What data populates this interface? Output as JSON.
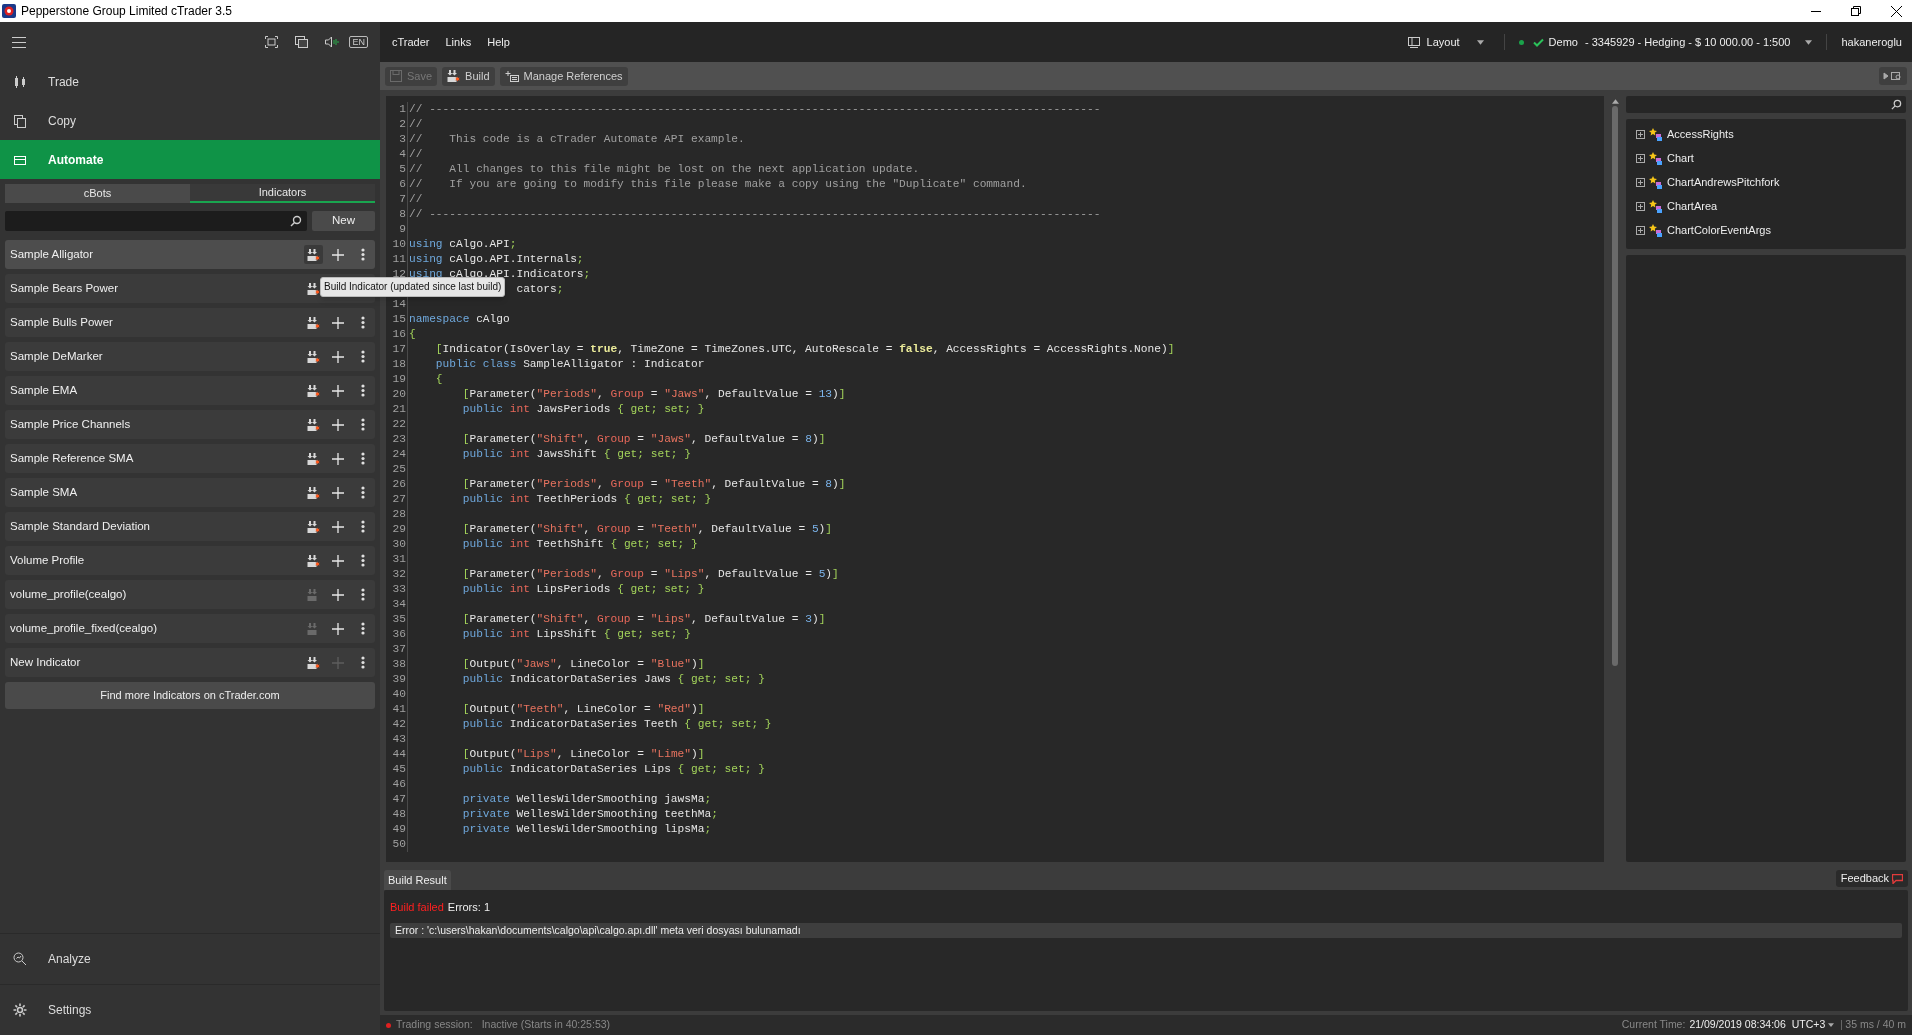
{
  "window": {
    "title": "Pepperstone Group Limited cTrader 3.5"
  },
  "sidebar": {
    "keyboard_badge": "EN",
    "nav_top": [
      {
        "label": "Trade",
        "kind": "trade",
        "selected": false
      },
      {
        "label": "Copy",
        "kind": "copy",
        "selected": false
      },
      {
        "label": "Automate",
        "kind": "automate",
        "selected": true
      }
    ],
    "tabs": [
      {
        "label": "cBots",
        "selected": false
      },
      {
        "label": "Indicators",
        "selected": true
      }
    ],
    "new_button": "New",
    "items": [
      {
        "name": "Sample Alligator",
        "selected": true,
        "modified": true,
        "add_enabled": true
      },
      {
        "name": "Sample Bears Power",
        "selected": false,
        "modified": true,
        "tooltip": "Build Indicator (updated since last build)"
      },
      {
        "name": "Sample Bulls Power",
        "selected": false,
        "modified": true,
        "add_enabled": true
      },
      {
        "name": "Sample DeMarker",
        "selected": false,
        "modified": true,
        "add_enabled": true
      },
      {
        "name": "Sample EMA",
        "selected": false,
        "modified": true,
        "add_enabled": true
      },
      {
        "name": "Sample Price Channels",
        "selected": false,
        "modified": true,
        "add_enabled": true
      },
      {
        "name": "Sample Reference SMA",
        "selected": false,
        "modified": true,
        "add_enabled": true
      },
      {
        "name": "Sample SMA",
        "selected": false,
        "modified": true,
        "add_enabled": true
      },
      {
        "name": "Sample Standard Deviation",
        "selected": false,
        "modified": true,
        "add_enabled": true
      },
      {
        "name": "Volume Profile",
        "selected": false,
        "modified": true,
        "add_enabled": true
      },
      {
        "name": "volume_profile(cealgo)",
        "selected": false,
        "modified": false,
        "add_enabled": true
      },
      {
        "name": "volume_profile_fixed(cealgo)",
        "selected": false,
        "modified": false,
        "add_enabled": true
      },
      {
        "name": "New Indicator",
        "selected": false,
        "modified": true,
        "add_enabled": false
      }
    ],
    "find_more": "Find more Indicators on cTrader.com",
    "nav_bottom": [
      {
        "label": "Analyze",
        "kind": "analyze",
        "selected": false
      },
      {
        "label": "Settings",
        "kind": "settings",
        "selected": false
      }
    ]
  },
  "menu": [
    "cTrader",
    "Links",
    "Help"
  ],
  "header": {
    "layout": "Layout",
    "account_type": "Demo",
    "account": "- 3345929 - Hedging - $ 10 000.00 - 1:500",
    "user": "hakaneroglu"
  },
  "toolbar": [
    {
      "label": "Save",
      "kind": "save",
      "disabled": true
    },
    {
      "label": "Build",
      "kind": "build",
      "disabled": false
    },
    {
      "label": "Manage References",
      "kind": "references",
      "disabled": false
    }
  ],
  "code": [
    {
      "number": "1",
      "tokens": [
        {
          "kind": "comment",
          "text": "// ----------------------------------------------------------------------------------------------------"
        }
      ]
    },
    {
      "number": "2",
      "tokens": [
        {
          "kind": "comment",
          "text": "//"
        }
      ]
    },
    {
      "number": "3",
      "tokens": [
        {
          "kind": "comment",
          "text": "//    This code is a cTrader Automate API example."
        }
      ]
    },
    {
      "number": "4",
      "tokens": [
        {
          "kind": "comment",
          "text": "//"
        }
      ]
    },
    {
      "number": "5",
      "tokens": [
        {
          "kind": "comment",
          "text": "//    All changes to this file might be lost on the next application update."
        }
      ]
    },
    {
      "number": "6",
      "tokens": [
        {
          "kind": "comment",
          "text": "//    If you are going to modify this file please make a copy using the \"Duplicate\" command."
        }
      ]
    },
    {
      "number": "7",
      "tokens": [
        {
          "kind": "comment",
          "text": "//"
        }
      ]
    },
    {
      "number": "8",
      "tokens": [
        {
          "kind": "comment",
          "text": "// ----------------------------------------------------------------------------------------------------"
        }
      ]
    },
    {
      "number": "9"
    },
    {
      "number": "10",
      "tokens": [
        {
          "kind": "keyword",
          "text": "using"
        },
        {
          "kind": "plain",
          "text": " cAlgo.API"
        },
        {
          "kind": "punct",
          "text": ";"
        }
      ]
    },
    {
      "number": "11",
      "tokens": [
        {
          "kind": "keyword",
          "text": "using"
        },
        {
          "kind": "plain",
          "text": " cAlgo.API.Internals"
        },
        {
          "kind": "punct",
          "text": ";"
        }
      ]
    },
    {
      "number": "12",
      "tokens": [
        {
          "kind": "keyword",
          "text": "using"
        },
        {
          "kind": "plain",
          "text": " cAlgo.API.Indicators"
        },
        {
          "kind": "punct",
          "text": ";"
        }
      ]
    },
    {
      "tokens": [
        {
          "kind": "plain",
          "text": "                cators"
        },
        {
          "kind": "punct",
          "text": ";"
        }
      ]
    },
    {
      "number": "14"
    },
    {
      "number": "15",
      "tokens": [
        {
          "kind": "keyword",
          "text": "namespace"
        },
        {
          "kind": "plain",
          "text": " cAlgo"
        }
      ]
    },
    {
      "number": "16",
      "tokens": [
        {
          "kind": "punct",
          "text": "{"
        }
      ]
    },
    {
      "number": "17",
      "tokens": [
        {
          "kind": "punct",
          "text": "    ["
        },
        {
          "kind": "plain",
          "text": "Indicator(IsOverlay = "
        },
        {
          "kind": "literal",
          "text": "true"
        },
        {
          "kind": "plain",
          "text": ", TimeZone = TimeZones.UTC, AutoRescale = "
        },
        {
          "kind": "literal",
          "text": "false"
        },
        {
          "kind": "plain",
          "text": ", AccessRights = AccessRights.None)"
        },
        {
          "kind": "punct",
          "text": "]"
        }
      ]
    },
    {
      "number": "18",
      "tokens": [
        {
          "kind": "keyword",
          "text": "    public class"
        },
        {
          "kind": "plain",
          "text": " SampleAlligator : Indicator"
        }
      ]
    },
    {
      "number": "19",
      "tokens": [
        {
          "kind": "punct",
          "text": "    {"
        }
      ]
    },
    {
      "number": "20",
      "tokens": [
        {
          "kind": "punct",
          "text": "        ["
        },
        {
          "kind": "plain",
          "text": "Parameter("
        },
        {
          "kind": "string",
          "text": "\"Periods\""
        },
        {
          "kind": "plain",
          "text": ", "
        },
        {
          "kind": "param",
          "text": "Group"
        },
        {
          "kind": "plain",
          "text": " = "
        },
        {
          "kind": "string",
          "text": "\"Jaws\""
        },
        {
          "kind": "plain",
          "text": ", DefaultValue = "
        },
        {
          "kind": "number",
          "text": "13"
        },
        {
          "kind": "plain",
          "text": ")"
        },
        {
          "kind": "punct",
          "text": "]"
        }
      ]
    },
    {
      "number": "21",
      "tokens": [
        {
          "kind": "keyword",
          "text": "        public"
        },
        {
          "kind": "type",
          "text": " int"
        },
        {
          "kind": "plain",
          "text": " JawsPeriods "
        },
        {
          "kind": "punct",
          "text": "{ get; set; }"
        }
      ]
    },
    {
      "number": "22"
    },
    {
      "number": "23",
      "tokens": [
        {
          "kind": "punct",
          "text": "        ["
        },
        {
          "kind": "plain",
          "text": "Parameter("
        },
        {
          "kind": "string",
          "text": "\"Shift\""
        },
        {
          "kind": "plain",
          "text": ", "
        },
        {
          "kind": "param",
          "text": "Group"
        },
        {
          "kind": "plain",
          "text": " = "
        },
        {
          "kind": "string",
          "text": "\"Jaws\""
        },
        {
          "kind": "plain",
          "text": ", DefaultValue = "
        },
        {
          "kind": "number",
          "text": "8"
        },
        {
          "kind": "plain",
          "text": ")"
        },
        {
          "kind": "punct",
          "text": "]"
        }
      ]
    },
    {
      "number": "24",
      "tokens": [
        {
          "kind": "keyword",
          "text": "        public"
        },
        {
          "kind": "type",
          "text": " int"
        },
        {
          "kind": "plain",
          "text": " JawsShift "
        },
        {
          "kind": "punct",
          "text": "{ get; set; }"
        }
      ]
    },
    {
      "number": "25"
    },
    {
      "number": "26",
      "tokens": [
        {
          "kind": "punct",
          "text": "        ["
        },
        {
          "kind": "plain",
          "text": "Parameter("
        },
        {
          "kind": "string",
          "text": "\"Periods\""
        },
        {
          "kind": "plain",
          "text": ", "
        },
        {
          "kind": "param",
          "text": "Group"
        },
        {
          "kind": "plain",
          "text": " = "
        },
        {
          "kind": "string",
          "text": "\"Teeth\""
        },
        {
          "kind": "plain",
          "text": ", DefaultValue = "
        },
        {
          "kind": "number",
          "text": "8"
        },
        {
          "kind": "plain",
          "text": ")"
        },
        {
          "kind": "punct",
          "text": "]"
        }
      ]
    },
    {
      "number": "27",
      "tokens": [
        {
          "kind": "keyword",
          "text": "        public"
        },
        {
          "kind": "type",
          "text": " int"
        },
        {
          "kind": "plain",
          "text": " TeethPeriods "
        },
        {
          "kind": "punct",
          "text": "{ get; set; }"
        }
      ]
    },
    {
      "number": "28"
    },
    {
      "number": "29",
      "tokens": [
        {
          "kind": "punct",
          "text": "        ["
        },
        {
          "kind": "plain",
          "text": "Parameter("
        },
        {
          "kind": "string",
          "text": "\"Shift\""
        },
        {
          "kind": "plain",
          "text": ", "
        },
        {
          "kind": "param",
          "text": "Group"
        },
        {
          "kind": "plain",
          "text": " = "
        },
        {
          "kind": "string",
          "text": "\"Teeth\""
        },
        {
          "kind": "plain",
          "text": ", DefaultValue = "
        },
        {
          "kind": "number",
          "text": "5"
        },
        {
          "kind": "plain",
          "text": ")"
        },
        {
          "kind": "punct",
          "text": "]"
        }
      ]
    },
    {
      "number": "30",
      "tokens": [
        {
          "kind": "keyword",
          "text": "        public"
        },
        {
          "kind": "type",
          "text": " int"
        },
        {
          "kind": "plain",
          "text": " TeethShift "
        },
        {
          "kind": "punct",
          "text": "{ get; set; }"
        }
      ]
    },
    {
      "number": "31"
    },
    {
      "number": "32",
      "tokens": [
        {
          "kind": "punct",
          "text": "        ["
        },
        {
          "kind": "plain",
          "text": "Parameter("
        },
        {
          "kind": "string",
          "text": "\"Periods\""
        },
        {
          "kind": "plain",
          "text": ", "
        },
        {
          "kind": "param",
          "text": "Group"
        },
        {
          "kind": "plain",
          "text": " = "
        },
        {
          "kind": "string",
          "text": "\"Lips\""
        },
        {
          "kind": "plain",
          "text": ", DefaultValue = "
        },
        {
          "kind": "number",
          "text": "5"
        },
        {
          "kind": "plain",
          "text": ")"
        },
        {
          "kind": "punct",
          "text": "]"
        }
      ]
    },
    {
      "number": "33",
      "tokens": [
        {
          "kind": "keyword",
          "text": "        public"
        },
        {
          "kind": "type",
          "text": " int"
        },
        {
          "kind": "plain",
          "text": " LipsPeriods "
        },
        {
          "kind": "punct",
          "text": "{ get; set; }"
        }
      ]
    },
    {
      "number": "34"
    },
    {
      "number": "35",
      "tokens": [
        {
          "kind": "punct",
          "text": "        ["
        },
        {
          "kind": "plain",
          "text": "Parameter("
        },
        {
          "kind": "string",
          "text": "\"Shift\""
        },
        {
          "kind": "plain",
          "text": ", "
        },
        {
          "kind": "param",
          "text": "Group"
        },
        {
          "kind": "plain",
          "text": " = "
        },
        {
          "kind": "string",
          "text": "\"Lips\""
        },
        {
          "kind": "plain",
          "text": ", DefaultValue = "
        },
        {
          "kind": "number",
          "text": "3"
        },
        {
          "kind": "plain",
          "text": ")"
        },
        {
          "kind": "punct",
          "text": "]"
        }
      ]
    },
    {
      "number": "36",
      "tokens": [
        {
          "kind": "keyword",
          "text": "        public"
        },
        {
          "kind": "type",
          "text": " int"
        },
        {
          "kind": "plain",
          "text": " LipsShift "
        },
        {
          "kind": "punct",
          "text": "{ get; set; }"
        }
      ]
    },
    {
      "number": "37"
    },
    {
      "number": "38",
      "tokens": [
        {
          "kind": "punct",
          "text": "        ["
        },
        {
          "kind": "plain",
          "text": "Output("
        },
        {
          "kind": "string",
          "text": "\"Jaws\""
        },
        {
          "kind": "plain",
          "text": ", LineColor = "
        },
        {
          "kind": "string",
          "text": "\"Blue\""
        },
        {
          "kind": "plain",
          "text": ")"
        },
        {
          "kind": "punct",
          "text": "]"
        }
      ]
    },
    {
      "number": "39",
      "tokens": [
        {
          "kind": "keyword",
          "text": "        public"
        },
        {
          "kind": "plain",
          "text": " IndicatorDataSeries Jaws "
        },
        {
          "kind": "punct",
          "text": "{ get; set; }"
        }
      ]
    },
    {
      "number": "40"
    },
    {
      "number": "41",
      "tokens": [
        {
          "kind": "punct",
          "text": "        ["
        },
        {
          "kind": "plain",
          "text": "Output("
        },
        {
          "kind": "string",
          "text": "\"Teeth\""
        },
        {
          "kind": "plain",
          "text": ", LineColor = "
        },
        {
          "kind": "string",
          "text": "\"Red\""
        },
        {
          "kind": "plain",
          "text": ")"
        },
        {
          "kind": "punct",
          "text": "]"
        }
      ]
    },
    {
      "number": "42",
      "tokens": [
        {
          "kind": "keyword",
          "text": "        public"
        },
        {
          "kind": "plain",
          "text": " IndicatorDataSeries Teeth "
        },
        {
          "kind": "punct",
          "text": "{ get; set; }"
        }
      ]
    },
    {
      "number": "43"
    },
    {
      "number": "44",
      "tokens": [
        {
          "kind": "punct",
          "text": "        ["
        },
        {
          "kind": "plain",
          "text": "Output("
        },
        {
          "kind": "string",
          "text": "\"Lips\""
        },
        {
          "kind": "plain",
          "text": ", LineColor = "
        },
        {
          "kind": "string",
          "text": "\"Lime\""
        },
        {
          "kind": "plain",
          "text": ")"
        },
        {
          "kind": "punct",
          "text": "]"
        }
      ]
    },
    {
      "number": "45",
      "tokens": [
        {
          "kind": "keyword",
          "text": "        public"
        },
        {
          "kind": "plain",
          "text": " IndicatorDataSeries Lips "
        },
        {
          "kind": "punct",
          "text": "{ get; set; }"
        }
      ]
    },
    {
      "number": "46"
    },
    {
      "number": "47",
      "tokens": [
        {
          "kind": "keyword",
          "text": "        private"
        },
        {
          "kind": "plain",
          "text": " WellesWilderSmoothing jawsMa"
        },
        {
          "kind": "punct",
          "text": ";"
        }
      ]
    },
    {
      "number": "48",
      "tokens": [
        {
          "kind": "keyword",
          "text": "        private"
        },
        {
          "kind": "plain",
          "text": " WellesWilderSmoothing teethMa"
        },
        {
          "kind": "punct",
          "text": ";"
        }
      ]
    },
    {
      "number": "49",
      "tokens": [
        {
          "kind": "keyword",
          "text": "        private"
        },
        {
          "kind": "plain",
          "text": " WellesWilderSmoothing lipsMa"
        },
        {
          "kind": "punct",
          "text": ";"
        }
      ]
    },
    {
      "number": "50"
    }
  ],
  "tree": [
    {
      "label": "AccessRights",
      "expanded": false
    },
    {
      "label": "Chart",
      "expanded": false
    },
    {
      "label": "ChartAndrewsPitchfork",
      "expanded": false
    },
    {
      "label": "ChartArea",
      "expanded": false
    },
    {
      "label": "ChartColorEventArgs",
      "expanded": false
    }
  ],
  "build_result": {
    "tab": "Build Result",
    "feedback": "Feedback",
    "status": "Build failed",
    "errors": "Errors: 1",
    "messages": [
      "Error : 'c:\\users\\hakan\\documents\\calgo\\api\\calgo.apı.dll' meta veri dosyası bulunamadı"
    ]
  },
  "status_bar": {
    "session_label": "Trading session:",
    "session": "Inactive (Starts in 40:25:53)",
    "time_label": "Current Time:",
    "time": "21/09/2019 08:34:06",
    "timezone": "UTC+3",
    "latency": "35 ms / 40 m"
  }
}
